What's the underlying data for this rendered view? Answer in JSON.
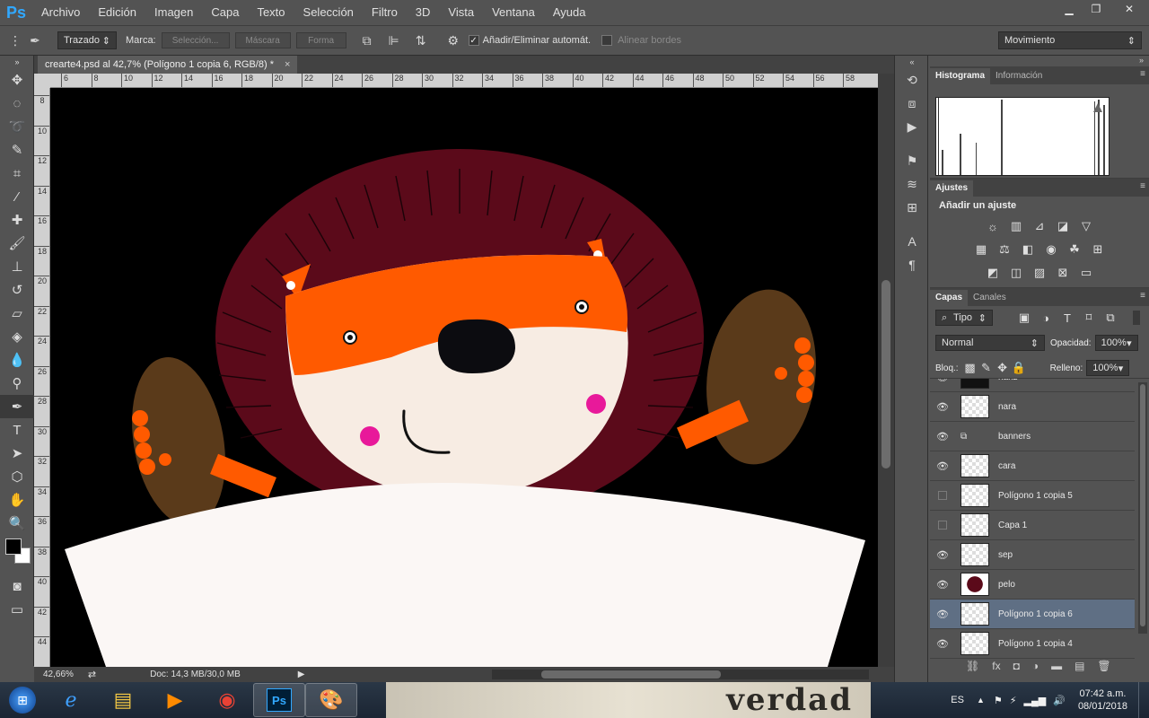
{
  "app": {
    "logo": "Ps"
  },
  "menu": [
    "Archivo",
    "Edición",
    "Imagen",
    "Capa",
    "Texto",
    "Selección",
    "Filtro",
    "3D",
    "Vista",
    "Ventana",
    "Ayuda"
  ],
  "window_controls": {
    "minimize": "▁",
    "restore": "❐",
    "close": "✕"
  },
  "options": {
    "mode_value": "Trazado",
    "marca_label": "Marca:",
    "seleccion_btn": "Selección...",
    "mascara_btn": "Máscara",
    "forma_btn": "Forma",
    "auto_add_label": "Añadir/Eliminar automát.",
    "align_edges_label": "Alinear bordes",
    "workspace_value": "Movimiento",
    "auto_add_checked": "✓"
  },
  "document": {
    "tab_title": "crearte4.psd al 42,7% (Polígono 1 copia 6, RGB/8) *",
    "tab_close": "×",
    "zoom": "42,66%",
    "doc_info": "Doc: 14,3 MB/30,0 MB"
  },
  "ruler": {
    "h": [
      "6",
      "8",
      "10",
      "12",
      "14",
      "16",
      "18",
      "20",
      "22",
      "24",
      "26",
      "28",
      "30",
      "32",
      "34",
      "36",
      "38",
      "40",
      "42",
      "44",
      "46",
      "48",
      "50",
      "52",
      "54",
      "56",
      "58"
    ],
    "v": [
      "8",
      "10",
      "12",
      "14",
      "16",
      "18",
      "20",
      "22",
      "24",
      "26",
      "28",
      "30",
      "32",
      "34",
      "36",
      "38",
      "40",
      "42",
      "44"
    ]
  },
  "panels": {
    "histogram_tab": "Histograma",
    "info_tab": "Información",
    "adjustments_tab": "Ajustes",
    "add_adjustment": "Añadir un ajuste",
    "layers_tab": "Capas",
    "channels_tab": "Canales",
    "kind_filter": "Tipo",
    "blend_mode": "Normal",
    "opacity_label": "Opacidad:",
    "opacity_value": "100%",
    "lock_label": "Bloq.:",
    "fill_label": "Relleno:",
    "fill_value": "100%"
  },
  "layers": [
    {
      "name": "nariz",
      "visible": true
    },
    {
      "name": "nara",
      "visible": true
    },
    {
      "name": "banners",
      "visible": true
    },
    {
      "name": "cara",
      "visible": true
    },
    {
      "name": "Polígono 1 copia 5",
      "visible": false
    },
    {
      "name": "Capa 1",
      "visible": false
    },
    {
      "name": "sep",
      "visible": true
    },
    {
      "name": "pelo",
      "visible": true
    },
    {
      "name": "Polígono 1 copia 6",
      "visible": true
    },
    {
      "name": "Polígono 1 copia 4",
      "visible": true
    }
  ],
  "taskbar": {
    "lang": "ES",
    "time": "07:42 a.m.",
    "date": "08/01/2018",
    "ps_label": "Ps",
    "bg_text": "verdad"
  },
  "colors": {
    "mane": "#5b0a1a",
    "fur": "#ff5a00",
    "face": "#f7ece3",
    "cymbal": "#5a3a1a",
    "cheek": "#e8199a",
    "selected_layer": "#5f6f84"
  }
}
